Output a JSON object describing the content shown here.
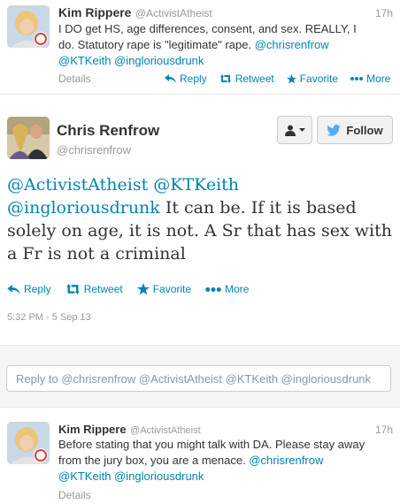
{
  "tweet1": {
    "name": "Kim Rippere",
    "handle": "@ActivistAtheist",
    "time": "17h",
    "text_lines": [
      "I DO get HS, age differences, consent, and sex. REALLY, I",
      "do.  Statutory rape is \"legitimate\" rape.",
      "@KTKeith @ingloriousdrunk"
    ],
    "mention_inline": "@chrisrenfrow",
    "details": "Details",
    "reply": "Reply",
    "retweet": "Retweet",
    "favorite": "Favorite",
    "more": "More"
  },
  "main": {
    "name": "Chris Renfrow",
    "handle": "@chrisrenfrow",
    "follow": "Follow",
    "mentions1": "@ActivistAtheist @KTKeith",
    "mention2": "@ingloriousdrunk",
    "text2": " It can be. If it is based",
    "text3": "solely on age, it is not. A Sr that has sex with",
    "text4": "a Fr is not a criminal",
    "reply": "Reply",
    "retweet": "Retweet",
    "favorite": "Favorite",
    "more": "More",
    "timestamp": "5:32 PM - 5 Sep 13"
  },
  "reply_box": {
    "placeholder": "Reply to @chrisrenfrow @ActivistAtheist @KTKeith @ingloriousdrunk"
  },
  "tweet2": {
    "name": "Kim Rippere",
    "handle": "@ActivistAtheist",
    "time": "17h",
    "text1": "Before stating that you might talk with DA.  Please stay away",
    "text2": "from the jury box, you are a menace.",
    "mention_inline": "@chrisrenfrow",
    "text3": "@KTKeith @ingloriousdrunk",
    "details": "Details"
  },
  "colors": {
    "link": "#0084b4",
    "follow_bg": "#f2f2f2"
  }
}
